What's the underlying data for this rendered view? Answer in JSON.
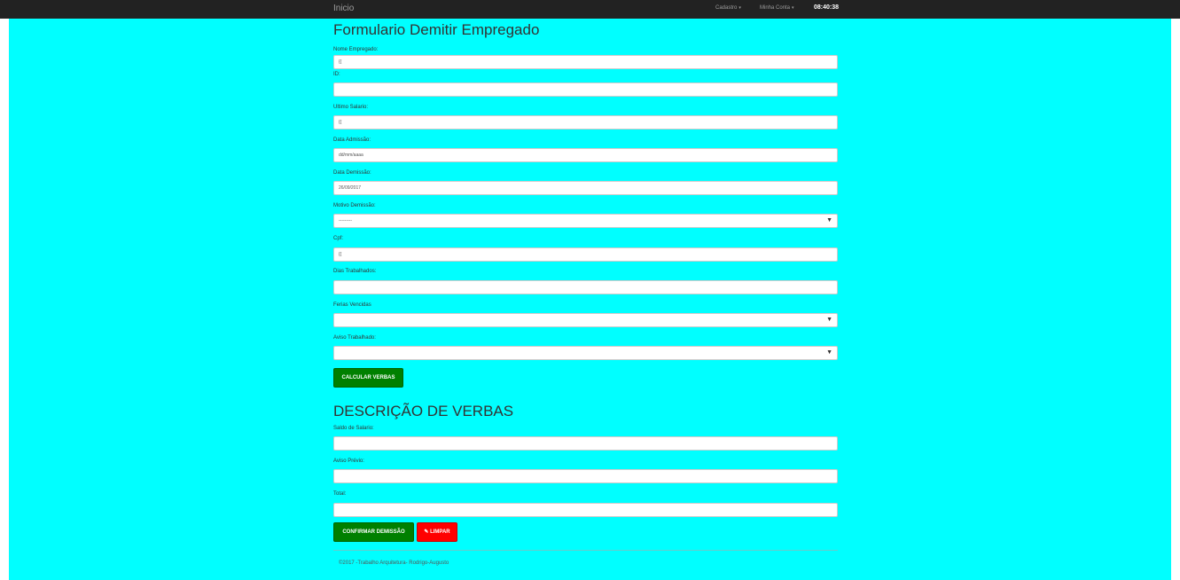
{
  "navbar": {
    "brand": "Inicio",
    "cadastro": "Cadastro",
    "minha_conta": "Minha Conta",
    "clock": "08:40:38"
  },
  "form": {
    "title": "Formulario Demitir Empregado",
    "fields": [
      {
        "label": "Nome Empregado:",
        "value": "{{",
        "type": "input"
      },
      {
        "label": "ID:",
        "value": "",
        "type": "input"
      },
      {
        "label": "Ultimo Salario:",
        "value": "{{",
        "type": "input"
      },
      {
        "label": "Data Admissão:",
        "value": "dd/mm/aaaa",
        "type": "input"
      },
      {
        "label": "Data Demissão:",
        "value": "26/09/2017",
        "type": "input"
      },
      {
        "label": "Motivo Demissão:",
        "value": "---------",
        "type": "select"
      },
      {
        "label": "Cpf:",
        "value": "{{",
        "type": "input"
      },
      {
        "label": "Dias Trabalhados:",
        "value": "",
        "type": "input"
      },
      {
        "label": "Ferias Vencidas",
        "value": "",
        "type": "select"
      },
      {
        "label": "Aviso Trabalhado:",
        "value": "",
        "type": "select"
      }
    ],
    "calc_button": "CALCULAR VERBAS"
  },
  "verbas": {
    "title": "DESCRIÇÃO DE VERBAS",
    "fields": [
      {
        "label": "Saldo de Salario:",
        "value": ""
      },
      {
        "label": "Aviso Prévio:",
        "value": ""
      },
      {
        "label": "Total:",
        "value": ""
      }
    ],
    "confirm_button": "CONFIRMAR DEMISSÃO",
    "clear_button": "LIMPAR"
  },
  "footer": {
    "text": "©2017 -Trabalho Arquitetura- Rodrigo-Augusto"
  },
  "colors": {
    "navbar": "#222222",
    "page_bg": "#00ffff",
    "confirm_green": "#008000",
    "clear_red": "#ff0000"
  },
  "icons": {
    "dropdown": "caret-down-icon",
    "select_arrow": "triangle-down-icon",
    "clear": "pencil-icon"
  }
}
